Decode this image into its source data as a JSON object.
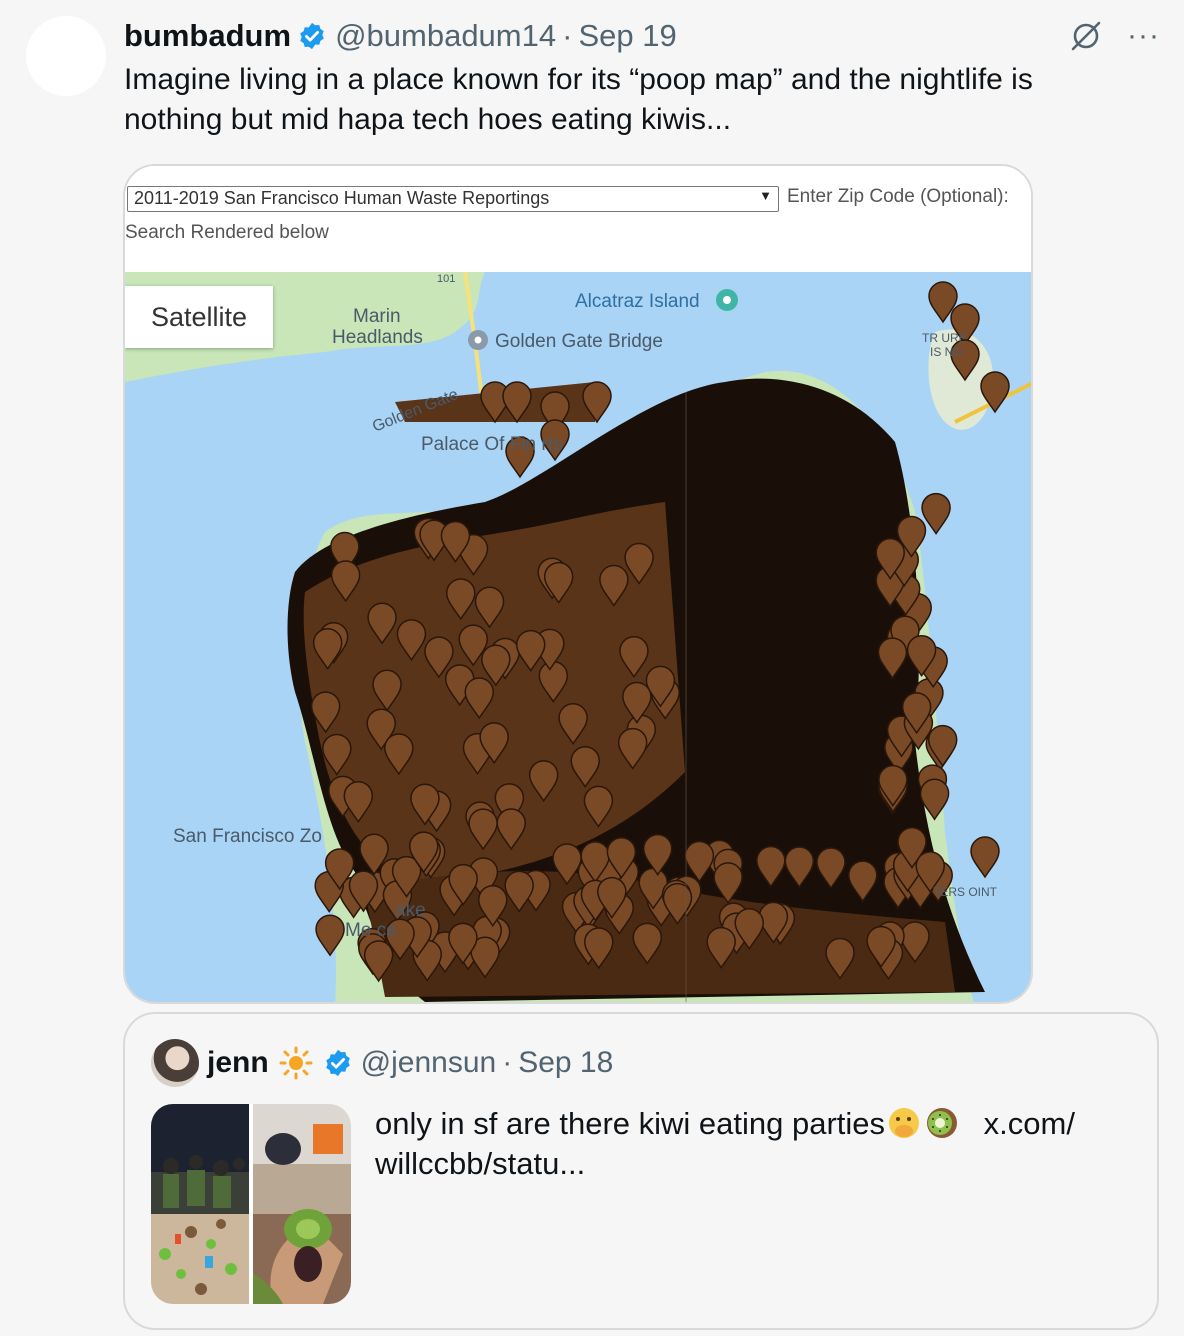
{
  "tweet": {
    "display_name": "bumbadum",
    "handle": "@bumbadum14",
    "separator": "·",
    "date": "Sep 19",
    "text": "Imagine living in a place known for its “poop map” and the nightlife is nothing but mid hapa tech hoes eating kiwis...",
    "more_label": "···",
    "verified_color": "#1d9bf0"
  },
  "media": {
    "dataset_select": "2011-2019 San Francisco Human Waste Reportings",
    "zip_label": "Enter Zip Code (Optional):",
    "rendered_label": "Search Rendered below",
    "satellite_button": "Satellite",
    "map_labels": {
      "marin": "Marin",
      "headlands": "Headlands",
      "alcatraz": "Alcatraz Island",
      "golden_gate_bridge": "Golden Gate Bridge",
      "golden_gate": "Golden Gate",
      "palace": "Palace Of Fin  rts",
      "sf_zoo": "San Francisco Zo",
      "treasure_1": "TR      URE",
      "treasure_2": "IS    ND",
      "hunters_point": "TERS  OINT",
      "lake": "ake",
      "merced": "Me ce",
      "route": "101"
    },
    "marker_color": "#7a4a26",
    "water_color": "#a9d4f5",
    "land_color": "#c8e6b8"
  },
  "quote": {
    "display_name": "jenn",
    "handle": "@jennsun",
    "separator": "·",
    "date": "Sep 18",
    "text_before": "only in sf are there kiwi eating parties",
    "text_after": "x.com/ willccbb/statu..."
  }
}
